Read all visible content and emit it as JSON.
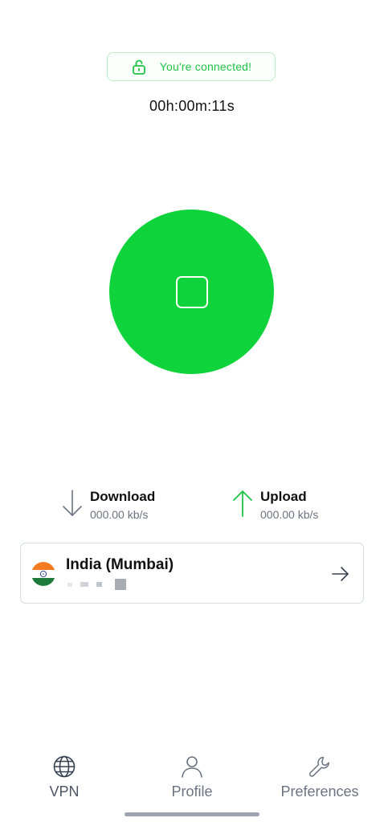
{
  "status": {
    "text": "You're connected!",
    "icon": "lock-open-icon",
    "color": "#1fc244"
  },
  "timer": "00h:00m:11s",
  "power_button": {
    "icon": "stop-square-icon",
    "color": "#0ed33a"
  },
  "stats": {
    "download": {
      "title": "Download",
      "value": "000.00 kb/s",
      "icon": "arrow-down-icon"
    },
    "upload": {
      "title": "Upload",
      "value": "000.00 kb/s",
      "icon": "arrow-up-icon",
      "color": "#1fc244"
    }
  },
  "server": {
    "name": "India (Mumbai)",
    "flag_icon": "india-flag-icon",
    "arrow_icon": "arrow-right-icon"
  },
  "nav": [
    {
      "label": "VPN",
      "icon": "globe-icon",
      "active": true
    },
    {
      "label": "Profile",
      "icon": "user-icon",
      "active": false
    },
    {
      "label": "Preferences",
      "icon": "wrench-icon",
      "active": false
    }
  ]
}
